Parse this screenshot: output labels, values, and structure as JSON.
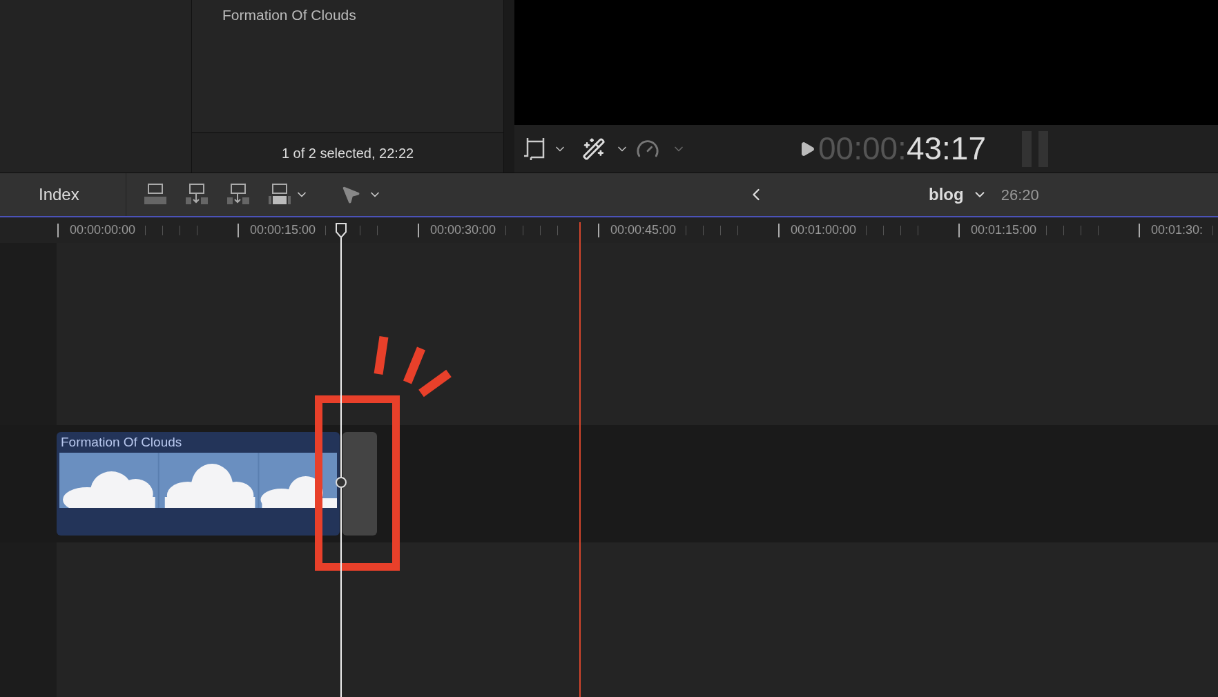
{
  "browser": {
    "clip_title": "Formation Of Clouds",
    "status": "1 of 2 selected, 22:22"
  },
  "viewer": {
    "timecode_dim": "00:00:",
    "timecode": "43:17"
  },
  "toolbar": {
    "index_label": "Index",
    "project": "blog",
    "duration": "26:20"
  },
  "ruler": {
    "labels": [
      "00:00:00:00",
      "00:00:15:00",
      "00:00:30:00",
      "00:00:45:00",
      "00:01:00:00",
      "00:01:15:00",
      "00:01:30:"
    ]
  },
  "timeline": {
    "clips": [
      {
        "kind": "video",
        "title": "Formation Of Clouds"
      },
      {
        "kind": "gap"
      }
    ]
  }
}
